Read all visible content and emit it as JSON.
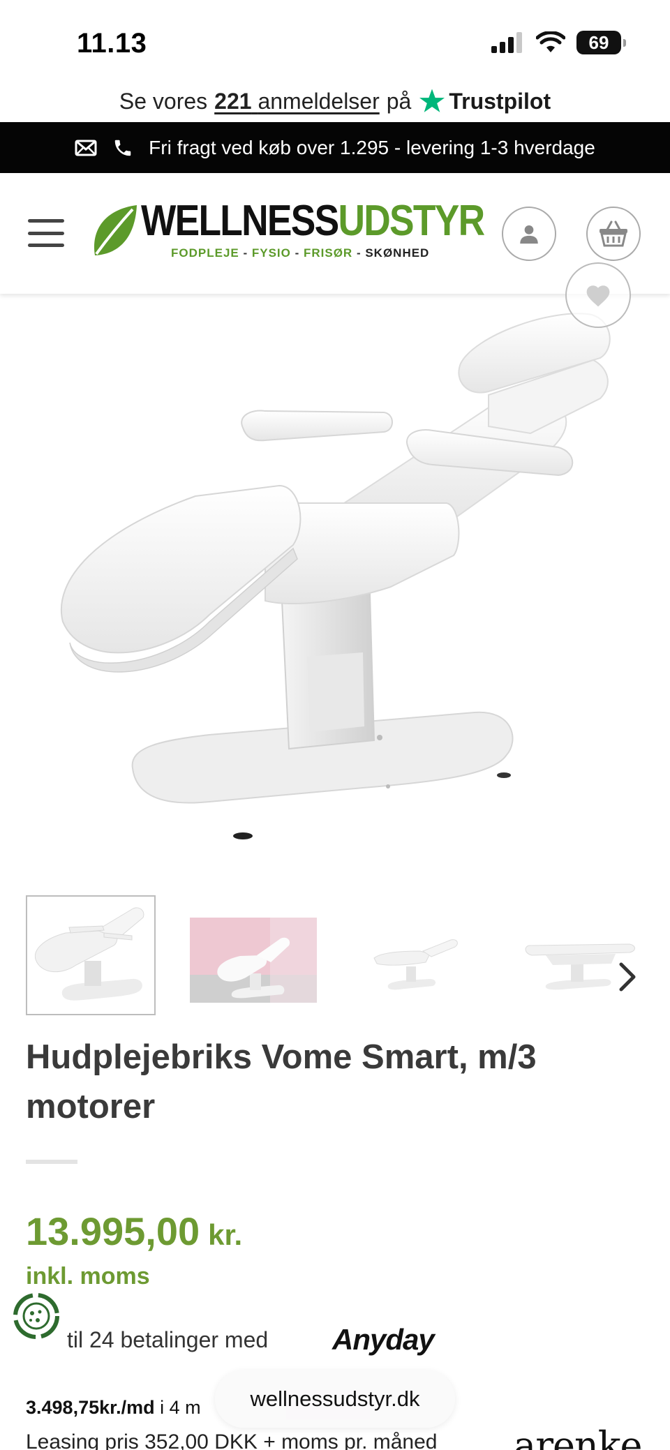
{
  "status_bar": {
    "time": "11.13",
    "battery": "69"
  },
  "trust_bar": {
    "prefix": "Se vores",
    "count": "221",
    "link": "anmeldelser",
    "suffix": "på",
    "brand": "Trustpilot",
    "brand_color": "#00b67a"
  },
  "info_bar": {
    "text": "Fri fragt ved køb over 1.295 - levering 1-3 hverdage"
  },
  "header": {
    "logo_part1": "WELLNESS",
    "logo_part2": "UDSTYR",
    "logo_sub": [
      {
        "text": "FODPLEJE",
        "color": "#5c9a2a"
      },
      {
        "text": " - ",
        "color": "#333333"
      },
      {
        "text": "FYSIO",
        "color": "#5c9a2a"
      },
      {
        "text": " - ",
        "color": "#333333"
      },
      {
        "text": "FRISØR",
        "color": "#5c9a2a"
      },
      {
        "text": " - ",
        "color": "#333333"
      },
      {
        "text": "SKØNHED",
        "color": "#222222"
      }
    ]
  },
  "product": {
    "title": "Hudplejebriks Vome Smart, m/3 motorer",
    "price": "13.995,00",
    "currency": "kr.",
    "tax_note": "inkl. moms",
    "price_color": "#6d9a32",
    "thumbnail_count": 4
  },
  "payment": {
    "anyday_text": "til 24 betalinger med",
    "anyday_brand": "Anyday",
    "monthly_amount": "3.498,75kr./md",
    "monthly_suffix": "i 4 m",
    "leasing_text": "Leasing pris 352,00 DKK + moms pr. måned",
    "leasing_brand": "arenke"
  },
  "browser": {
    "url": "wellnessudstyr.dk"
  },
  "colors": {
    "brand_green": "#5c9a2a",
    "info_bar_bg": "#050505"
  }
}
